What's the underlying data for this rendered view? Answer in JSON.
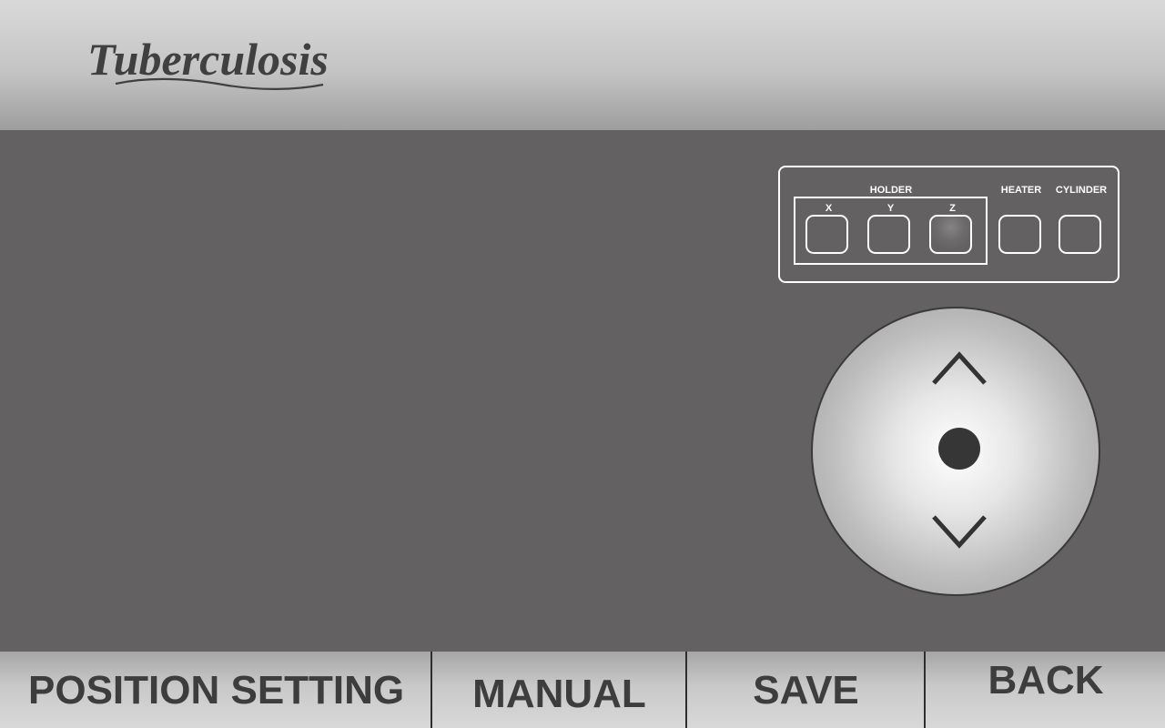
{
  "header": {
    "logo_text": "Tuberculosis"
  },
  "axis_panel": {
    "group_label": "HOLDER",
    "axes": [
      {
        "label": "X"
      },
      {
        "label": "Y"
      },
      {
        "label": "Z"
      }
    ],
    "heater_label": "HEATER",
    "cylinder_label": "CYLINDER"
  },
  "footer": {
    "title": "POSITION SETTING",
    "manual_label": "MANUAL",
    "save_label": "SAVE",
    "back_label": "BACK"
  },
  "colors": {
    "background": "#636162",
    "panel_border": "#ffffff",
    "text_dark": "#3d3d3d",
    "center_button": "#363636"
  },
  "icons": {
    "up": "chevron-up-icon",
    "down": "chevron-down-icon",
    "center": "center-dot-icon"
  }
}
